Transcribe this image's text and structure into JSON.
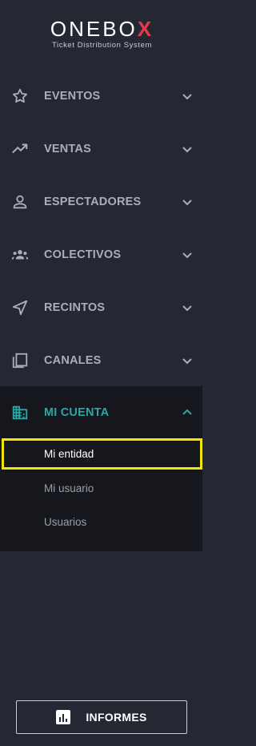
{
  "brand": {
    "name_main": "ONEBO",
    "name_accent": "X",
    "tagline": "Ticket Distribution System",
    "accent_color": "#e8394a"
  },
  "nav": {
    "items": [
      {
        "label": "EVENTOS",
        "icon": "star-icon"
      },
      {
        "label": "VENTAS",
        "icon": "trending-up-icon"
      },
      {
        "label": "ESPECTADORES",
        "icon": "person-icon"
      },
      {
        "label": "COLECTIVOS",
        "icon": "groups-icon"
      },
      {
        "label": "RECINTOS",
        "icon": "navigation-arrow-icon"
      },
      {
        "label": "CANALES",
        "icon": "copy-icon"
      }
    ],
    "account": {
      "label": "MI CUENTA",
      "icon": "building-icon",
      "expanded": true,
      "accent_color": "#2aa7a5",
      "subitems": [
        {
          "label": "Mi entidad",
          "active": true
        },
        {
          "label": "Mi usuario",
          "active": false
        },
        {
          "label": "Usuarios",
          "active": false
        }
      ]
    }
  },
  "footer": {
    "button_label": "INFORMES",
    "button_icon": "bar-chart-icon"
  },
  "colors": {
    "sidebar_bg": "#252833",
    "account_bg": "#16171d",
    "highlight": "#f2e600"
  }
}
